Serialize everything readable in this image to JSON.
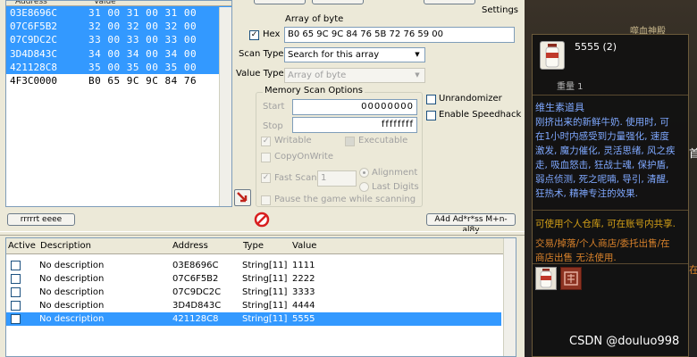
{
  "colors": {
    "selection": "#3399ff",
    "window_bg": "#ece9d8",
    "tooltip_bg": "#101010",
    "gold": "#d4a017",
    "blue": "#7fa8ff",
    "orange": "#d9822b"
  },
  "address_list": {
    "headers": [
      "Address",
      "Value"
    ],
    "rows": [
      {
        "address": "03E8696C",
        "value": "31 00 31 00 31 00",
        "selected": true
      },
      {
        "address": "07C6F5B2",
        "value": "32 00 32 00 32 00",
        "selected": true
      },
      {
        "address": "07C9DC2C",
        "value": "33 00 33 00 33 00",
        "selected": true
      },
      {
        "address": "3D4D843C",
        "value": "34 00 34 00 34 00",
        "selected": true
      },
      {
        "address": "421128C8",
        "value": "35 00 35 00 35 00",
        "selected": true
      },
      {
        "address": "4F3C0000",
        "value": "B0 65 9C 9C 84 76",
        "selected": false
      }
    ]
  },
  "scan": {
    "settings_label": "Settings",
    "array_of_byte_label": "Array of byte",
    "hex_label": "Hex",
    "hex_checked": true,
    "value": "B0 65 9C 9C 84 76 5B 72 76 59 00",
    "scan_type_label": "Scan Type",
    "scan_type_value": "Search for this array",
    "value_type_label": "Value Type",
    "value_type_value": "Array of byte",
    "memory_options_label": "Memory Scan Options",
    "start_label": "Start",
    "start_value": "00000000",
    "stop_label": "Stop",
    "stop_value": "ffffffff",
    "writable_label": "Writable",
    "executable_label": "Executable",
    "copy_on_write_label": "CopyOnWrite",
    "fast_scan_label": "Fast Scan",
    "fast_scan_value": "1",
    "alignment_label": "Alignment",
    "last_digits_label": "Last Digits",
    "pause_label": "Pause the game while scanning",
    "unrandomizer_label": "Unrandomizer",
    "enable_speedhack_label": "Enable Speedhack"
  },
  "buttons": {
    "left_button": "rrrrrt eeee",
    "add_address_button": "A4d Ad*r*ss M+n-al8y"
  },
  "cheat_table": {
    "headers": {
      "active": "Active",
      "description": "Description",
      "address": "Address",
      "type": "Type",
      "value": "Value"
    },
    "rows": [
      {
        "description": "No description",
        "address": "03E8696C",
        "type": "String[11]",
        "value": "1111",
        "selected": false
      },
      {
        "description": "No description",
        "address": "07C6F5B2",
        "type": "String[11]",
        "value": "2222",
        "selected": false
      },
      {
        "description": "No description",
        "address": "07C9DC2C",
        "type": "String[11]",
        "value": "3333",
        "selected": false
      },
      {
        "description": "No description",
        "address": "3D4D843C",
        "type": "String[11]",
        "value": "4444",
        "selected": false
      },
      {
        "description": "No description",
        "address": "421128C8",
        "type": "String[11]",
        "value": "5555",
        "selected": true
      }
    ]
  },
  "game_tooltip": {
    "item_name": "5555 (2)",
    "weight": "重量 1",
    "category": "维生素道具",
    "desc_lines": [
      "刚挤出来的新鲜牛奶. 使用时, 可",
      "在1小时内感受到力量强化, 速度",
      "激发, 魔力催化, 灵活思绪, 风之疾",
      "走, 吸血怒击, 狂战士魂, 保护盾,",
      "弱点侦测, 死之呢喃, 导引, 清醒,",
      "狂热术, 精神专注的效果."
    ],
    "usage": "可使用个人仓库, 可在账号内共享.",
    "trade_lines": [
      "交易/掉落/个人商店/委托出售/在",
      "商店出售 无法使用."
    ],
    "bg_text_top": "噬血神殿",
    "bg_text_side": "首",
    "bg_text_side2": "在"
  },
  "watermark": "CSDN @douluo998"
}
